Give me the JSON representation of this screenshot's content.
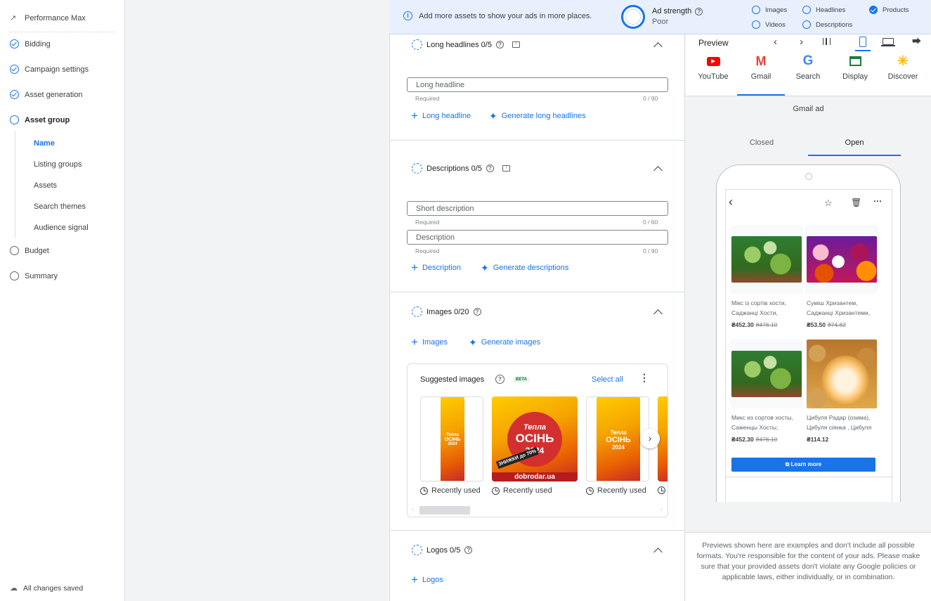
{
  "sidebar": {
    "campaign_type": "Performance Max",
    "steps": [
      {
        "label": "Bidding",
        "state": "done"
      },
      {
        "label": "Campaign settings",
        "state": "done"
      },
      {
        "label": "Asset generation",
        "state": "done"
      },
      {
        "label": "Asset group",
        "state": "current"
      },
      {
        "label": "Budget",
        "state": "todo"
      },
      {
        "label": "Summary",
        "state": "todo"
      }
    ],
    "substeps": [
      "Name",
      "Listing groups",
      "Assets",
      "Search themes",
      "Audience signal"
    ],
    "saved_status": "All changes saved"
  },
  "banner": {
    "message": "Add more assets to show your ads in more places.",
    "strength_label": "Ad strength",
    "strength_value": "Poor",
    "checks": [
      {
        "label": "Images",
        "checked": false
      },
      {
        "label": "Headlines",
        "checked": false
      },
      {
        "label": "Products",
        "checked": true
      },
      {
        "label": "Videos",
        "checked": false
      },
      {
        "label": "Descriptions",
        "checked": false
      }
    ]
  },
  "long_headlines": {
    "title": "Long headlines 0/5",
    "input_placeholder": "Long headline",
    "required": "Required",
    "counter": "0 / 90",
    "add_label": "Long headline",
    "generate_label": "Generate long headlines"
  },
  "descriptions": {
    "title": "Descriptions 0/5",
    "short_placeholder": "Short description",
    "short_counter": "0 / 60",
    "long_placeholder": "Description",
    "long_counter": "0 / 90",
    "required": "Required",
    "add_label": "Description",
    "generate_label": "Generate descriptions"
  },
  "images": {
    "title": "Images 0/20",
    "add_label": "Images",
    "generate_label": "Generate images",
    "suggested_title": "Suggested images",
    "beta": "BETA",
    "select_all": "Select all",
    "recent_label": "Recently used",
    "poster_texts": {
      "line1": "Тепла",
      "line2": "ОСІНЬ",
      "year": "2024",
      "site": "dobrodar.ua",
      "sale": "ЗНИЖКИ до 70%"
    }
  },
  "logos": {
    "title": "Logos 0/5",
    "add_label": "Logos"
  },
  "preview": {
    "title": "Preview",
    "channels": [
      "YouTube",
      "Gmail",
      "Search",
      "Display",
      "Discover"
    ],
    "active_channel": "Gmail",
    "ad_label": "Gmail ad",
    "tabs": [
      "Closed",
      "Open"
    ],
    "active_tab": "Open",
    "products": [
      {
        "line1": "Мікс із сортів хости,",
        "line2": "Саджанці Хости,",
        "price": "₴452.30",
        "old_price": "₴476.10"
      },
      {
        "line1": "Суміш Хризантем,",
        "line2": "Саджанці Хризантеми,",
        "price": "₴53.50",
        "old_price": "₴74.82"
      },
      {
        "line1": "Микс из сортов хосты,",
        "line2": "Саженцы Хосты,",
        "price": "₴452.30",
        "old_price": "₴476.10"
      },
      {
        "line1": "Цибуля Радар (озима),",
        "line2": "Цибуля сіянка , Цибуля",
        "price": "₴114.12",
        "old_price": ""
      }
    ],
    "cta": "Learn more",
    "disclaimer": "Previews shown here are examples and don't include all possible formats. You're responsible for the content of your ads. Please make sure that your provided assets don't violate any Google policies or applicable laws, either individually, or in combination."
  },
  "colors": {
    "accent": "#1a73e8",
    "banner_bg": "#e8f0fe"
  }
}
